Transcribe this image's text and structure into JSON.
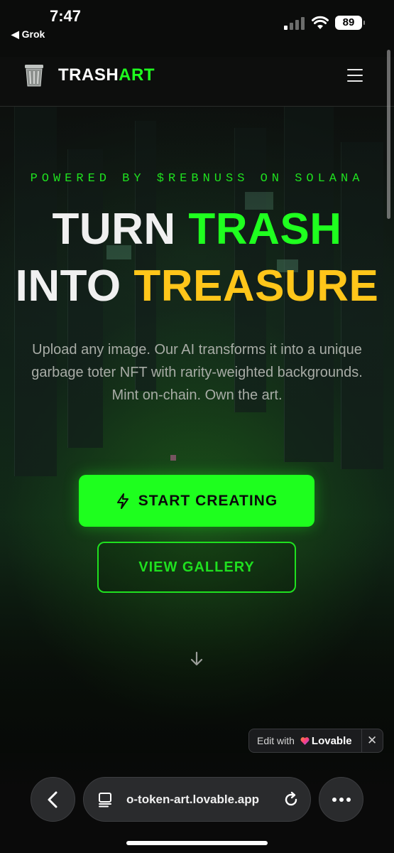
{
  "status_bar": {
    "time": "7:47",
    "back_app": "◀ Grok",
    "battery": "89"
  },
  "nav": {
    "brand_white": "TRASH",
    "brand_green": "ART",
    "menu_icon": "hamburger-icon",
    "logo_icon": "trash-bin-icon"
  },
  "hero": {
    "tagline": "POWERED BY $REBNUSS ON SOLANA",
    "line1_white": "TURN ",
    "line1_green": "TRASH",
    "line2_white": "INTO ",
    "line2_yellow": "TREASURE",
    "description": "Upload any image. Our AI transforms it into a unique garbage toter NFT with rarity-weighted backgrounds. Mint on-chain. Own the art.",
    "primary_button": "START CREATING",
    "secondary_button": "VIEW GALLERY"
  },
  "badge": {
    "text": "Edit with",
    "brand": "Lovable",
    "close": "✕"
  },
  "browser": {
    "url": "o-token-art.lovable.app"
  },
  "colors": {
    "accent_green": "#1fff1f",
    "accent_yellow": "#ffc61a",
    "background": "#0b0c0b"
  }
}
